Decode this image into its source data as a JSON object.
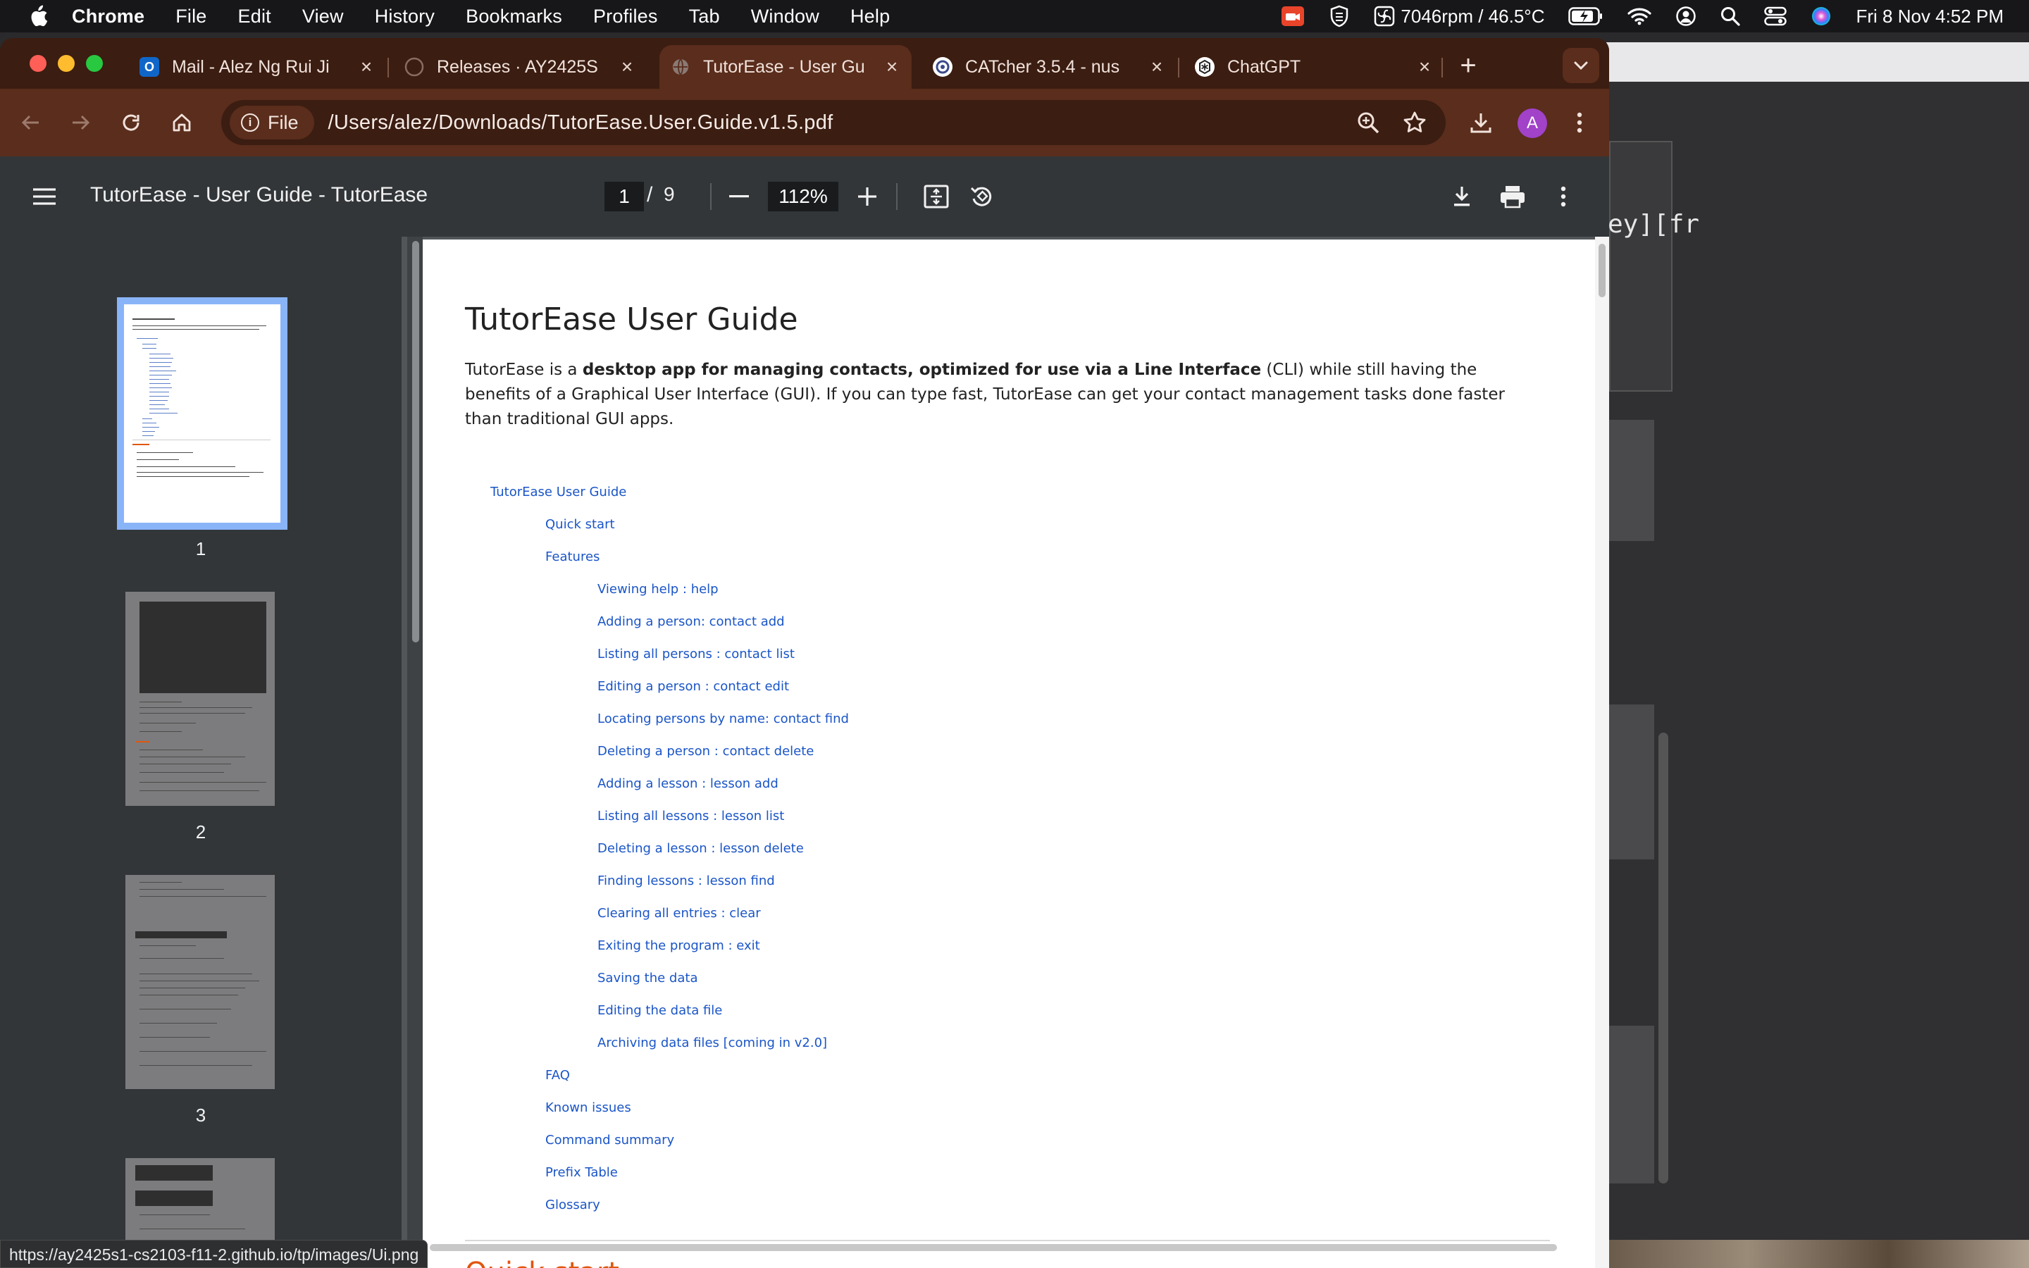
{
  "menubar": {
    "app_name": "Chrome",
    "items": [
      "File",
      "Edit",
      "View",
      "History",
      "Bookmarks",
      "Profiles",
      "Tab",
      "Window",
      "Help"
    ],
    "status": {
      "fan": "7046rpm / 46.5°C",
      "datetime": "Fri 8 Nov  4:52 PM"
    }
  },
  "tabs": [
    {
      "title": "Mail - Alez Ng Rui Ji",
      "icon": "outlook-icon",
      "active": false
    },
    {
      "title": "Releases · AY2425S",
      "icon": "github-icon",
      "active": false
    },
    {
      "title": "TutorEase - User Gu",
      "icon": "globe-icon",
      "active": true
    },
    {
      "title": "CATcher 3.5.4 - nus",
      "icon": "catcher-icon",
      "active": false
    },
    {
      "title": "ChatGPT",
      "icon": "chatgpt-icon",
      "active": false
    }
  ],
  "omnibox": {
    "chip_label": "File",
    "url": "/Users/alez/Downloads/TutorEase.User.Guide.v1.5.pdf"
  },
  "profile_initial": "A",
  "pdf_toolbar": {
    "title": "TutorEase - User Guide - TutorEase",
    "page_current": "1",
    "page_separator": "/",
    "page_total": "9",
    "zoom": "112%"
  },
  "thumbnails": [
    {
      "number": "1",
      "selected": true
    },
    {
      "number": "2",
      "selected": false
    },
    {
      "number": "3",
      "selected": false
    }
  ],
  "document": {
    "title": "TutorEase User Guide",
    "intro_1": "TutorEase is a ",
    "intro_bold": "desktop app for managing contacts, optimized for use via a Line Interface",
    "intro_2": " (CLI) while still having the benefits of a Graphical User Interface (GUI). If you can type fast, TutorEase can get your contact management tasks done faster than traditional GUI apps.",
    "toc": [
      {
        "label": "TutorEase User Guide",
        "level": 0
      },
      {
        "label": "Quick start",
        "level": 1
      },
      {
        "label": "Features",
        "level": 1
      },
      {
        "label": "Viewing help : help",
        "level": 2
      },
      {
        "label": "Adding a person: contact add",
        "level": 2
      },
      {
        "label": "Listing all persons : contact list",
        "level": 2
      },
      {
        "label": "Editing a person : contact edit",
        "level": 2
      },
      {
        "label": "Locating persons by name: contact find",
        "level": 2
      },
      {
        "label": "Deleting a person : contact delete",
        "level": 2
      },
      {
        "label": "Adding a lesson : lesson add",
        "level": 2
      },
      {
        "label": "Listing all lessons : lesson list",
        "level": 2
      },
      {
        "label": "Deleting a lesson : lesson delete",
        "level": 2
      },
      {
        "label": "Finding lessons : lesson find",
        "level": 2
      },
      {
        "label": "Clearing all entries : clear",
        "level": 2
      },
      {
        "label": "Exiting the program : exit",
        "level": 2
      },
      {
        "label": "Saving the data",
        "level": 2
      },
      {
        "label": "Editing the data file",
        "level": 2
      },
      {
        "label": "Archiving data files [coming in v2.0]",
        "level": 2
      },
      {
        "label": "FAQ",
        "level": 1
      },
      {
        "label": "Known issues",
        "level": 1
      },
      {
        "label": "Command summary",
        "level": 1
      },
      {
        "label": "Prefix Table",
        "level": 1
      },
      {
        "label": "Glossary",
        "level": 1
      }
    ],
    "next_heading": "Quick start"
  },
  "background_window_text": "ey][fr",
  "status_url": "https://ay2425s1-cs2103-f11-2.github.io/tp/images/Ui.png",
  "colors": {
    "tabstrip": "#3b1d12",
    "toolbar": "#5a2d1c",
    "link": "#1a55c7",
    "selected_thumb": "#8ab4f8",
    "heading_orange": "#e0570f"
  }
}
